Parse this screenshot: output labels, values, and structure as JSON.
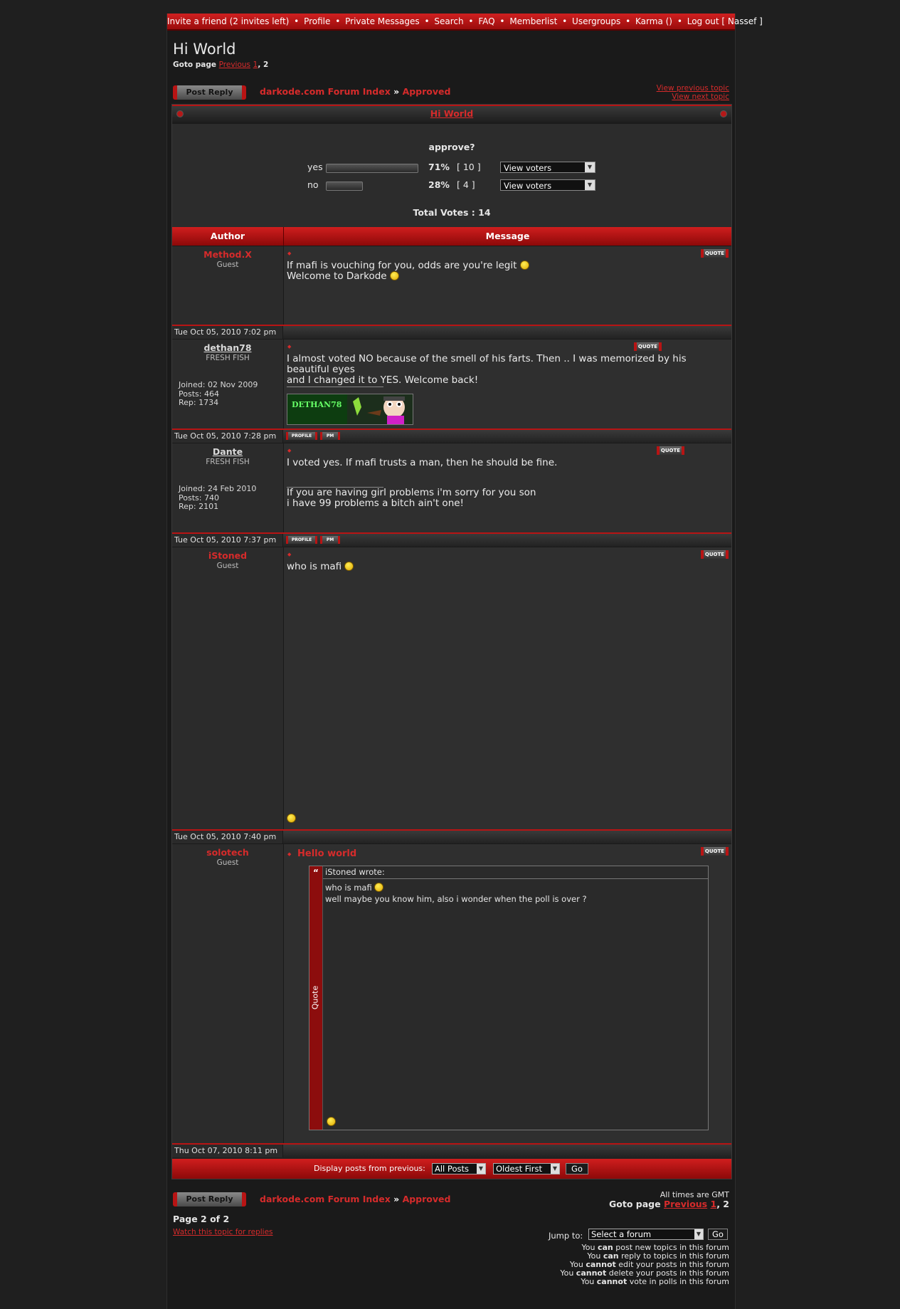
{
  "nav": {
    "items": [
      "Invite a friend (2 invites left)",
      "Profile",
      "Private Messages",
      "Search",
      "FAQ",
      "Memberlist",
      "Usergroups",
      "Karma ()",
      "Log out [ Nassef ]"
    ],
    "separator": "•"
  },
  "topic": {
    "title": "Hi World",
    "goto_label": "Goto page",
    "goto_prev": "Previous",
    "goto_page1": "1",
    "goto_page2": ", 2"
  },
  "buttons": {
    "post_reply": "Post Reply"
  },
  "breadcrumb": {
    "index": "darkode.com Forum Index",
    "arrow": "»",
    "forum": "Approved"
  },
  "topic_nav": {
    "prev": "View previous topic",
    "next": "View next topic"
  },
  "poll": {
    "title_bar": "Hi World",
    "question": "approve?",
    "options": [
      {
        "label": "yes",
        "percent_text": "71%",
        "count_text": "[ 10 ]",
        "voters": "View voters",
        "fraction": 0.71
      },
      {
        "label": "no",
        "percent_text": "28%",
        "count_text": "[ 4 ]",
        "voters": "View voters",
        "fraction": 0.28
      }
    ],
    "total": "Total Votes : 14"
  },
  "table_header": {
    "author": "Author",
    "message": "Message"
  },
  "posts": [
    {
      "author": "Method.X",
      "rank": "Guest",
      "lines": [
        "If mafi is vouching for you, odds are you're legit",
        "Welcome to Darkode"
      ],
      "date": "Tue Oct 05, 2010 7:02 pm",
      "quote": "QUOTE"
    },
    {
      "author": "dethan78",
      "rank": "FRESH FISH",
      "joined": "Joined: 02 Nov 2009",
      "posts": "Posts: 464",
      "rep": "Rep: 1734",
      "lines": [
        "I almost voted NO because of the smell of his farts. Then .. I was memorized by his beautiful eyes",
        "and I changed it to YES. Welcome back!"
      ],
      "sig_banner": "DETHAN78",
      "date": "Tue Oct 05, 2010 7:28 pm",
      "quote": "QUOTE",
      "profile": "PROFILE",
      "pm": "PM"
    },
    {
      "author": "Dante",
      "rank": "FRESH FISH",
      "joined": "Joined: 24 Feb 2010",
      "posts": "Posts: 740",
      "rep": "Rep: 2101",
      "lines": [
        "I voted yes. If mafi trusts a man, then he should be fine."
      ],
      "sig_lines": [
        "If you are having girl problems i'm sorry for you son",
        "i have 99 problems a bitch ain't one!"
      ],
      "date": "Tue Oct 05, 2010 7:37 pm",
      "quote": "QUOTE",
      "profile": "PROFILE",
      "pm": "PM"
    },
    {
      "author": "iStoned",
      "rank": "Guest",
      "lines": [
        "who is mafi"
      ],
      "date": "Tue Oct 05, 2010 7:40 pm",
      "quote": "QUOTE"
    },
    {
      "author": "solotech",
      "rank": "Guest",
      "subject": "Hello world",
      "quote_author": "iStoned wrote:",
      "quote_side": "Quote",
      "quote_lines": [
        "who is mafi",
        "well maybe you know him, also i wonder when the poll is over ?"
      ],
      "date": "Thu Oct 07, 2010 8:11 pm",
      "quote": "QUOTE"
    }
  ],
  "display": {
    "label": "Display posts from previous:",
    "range": "All Posts",
    "order": "Oldest First",
    "go": "Go"
  },
  "footer": {
    "timezone": "All times are GMT",
    "goto_label": "Goto page",
    "goto_prev": "Previous",
    "goto_page1": "1",
    "goto_page2": ", 2",
    "page_of": "Page 2 of 2",
    "watch": "Watch this topic for replies",
    "jump_label": "Jump to:",
    "jump_select": "Select a forum",
    "jump_go": "Go",
    "permissions": [
      {
        "pre": "You ",
        "bold": "can",
        "post": " post new topics in this forum"
      },
      {
        "pre": "You ",
        "bold": "can",
        "post": " reply to topics in this forum"
      },
      {
        "pre": "You ",
        "bold": "cannot",
        "post": " edit your posts in this forum"
      },
      {
        "pre": "You ",
        "bold": "cannot",
        "post": " delete your posts in this forum"
      },
      {
        "pre": "You ",
        "bold": "cannot",
        "post": " vote in polls in this forum"
      }
    ]
  },
  "colors": {
    "accent": "#d62b2b",
    "bar": "#b81414",
    "bg": "#1f1f1f"
  }
}
